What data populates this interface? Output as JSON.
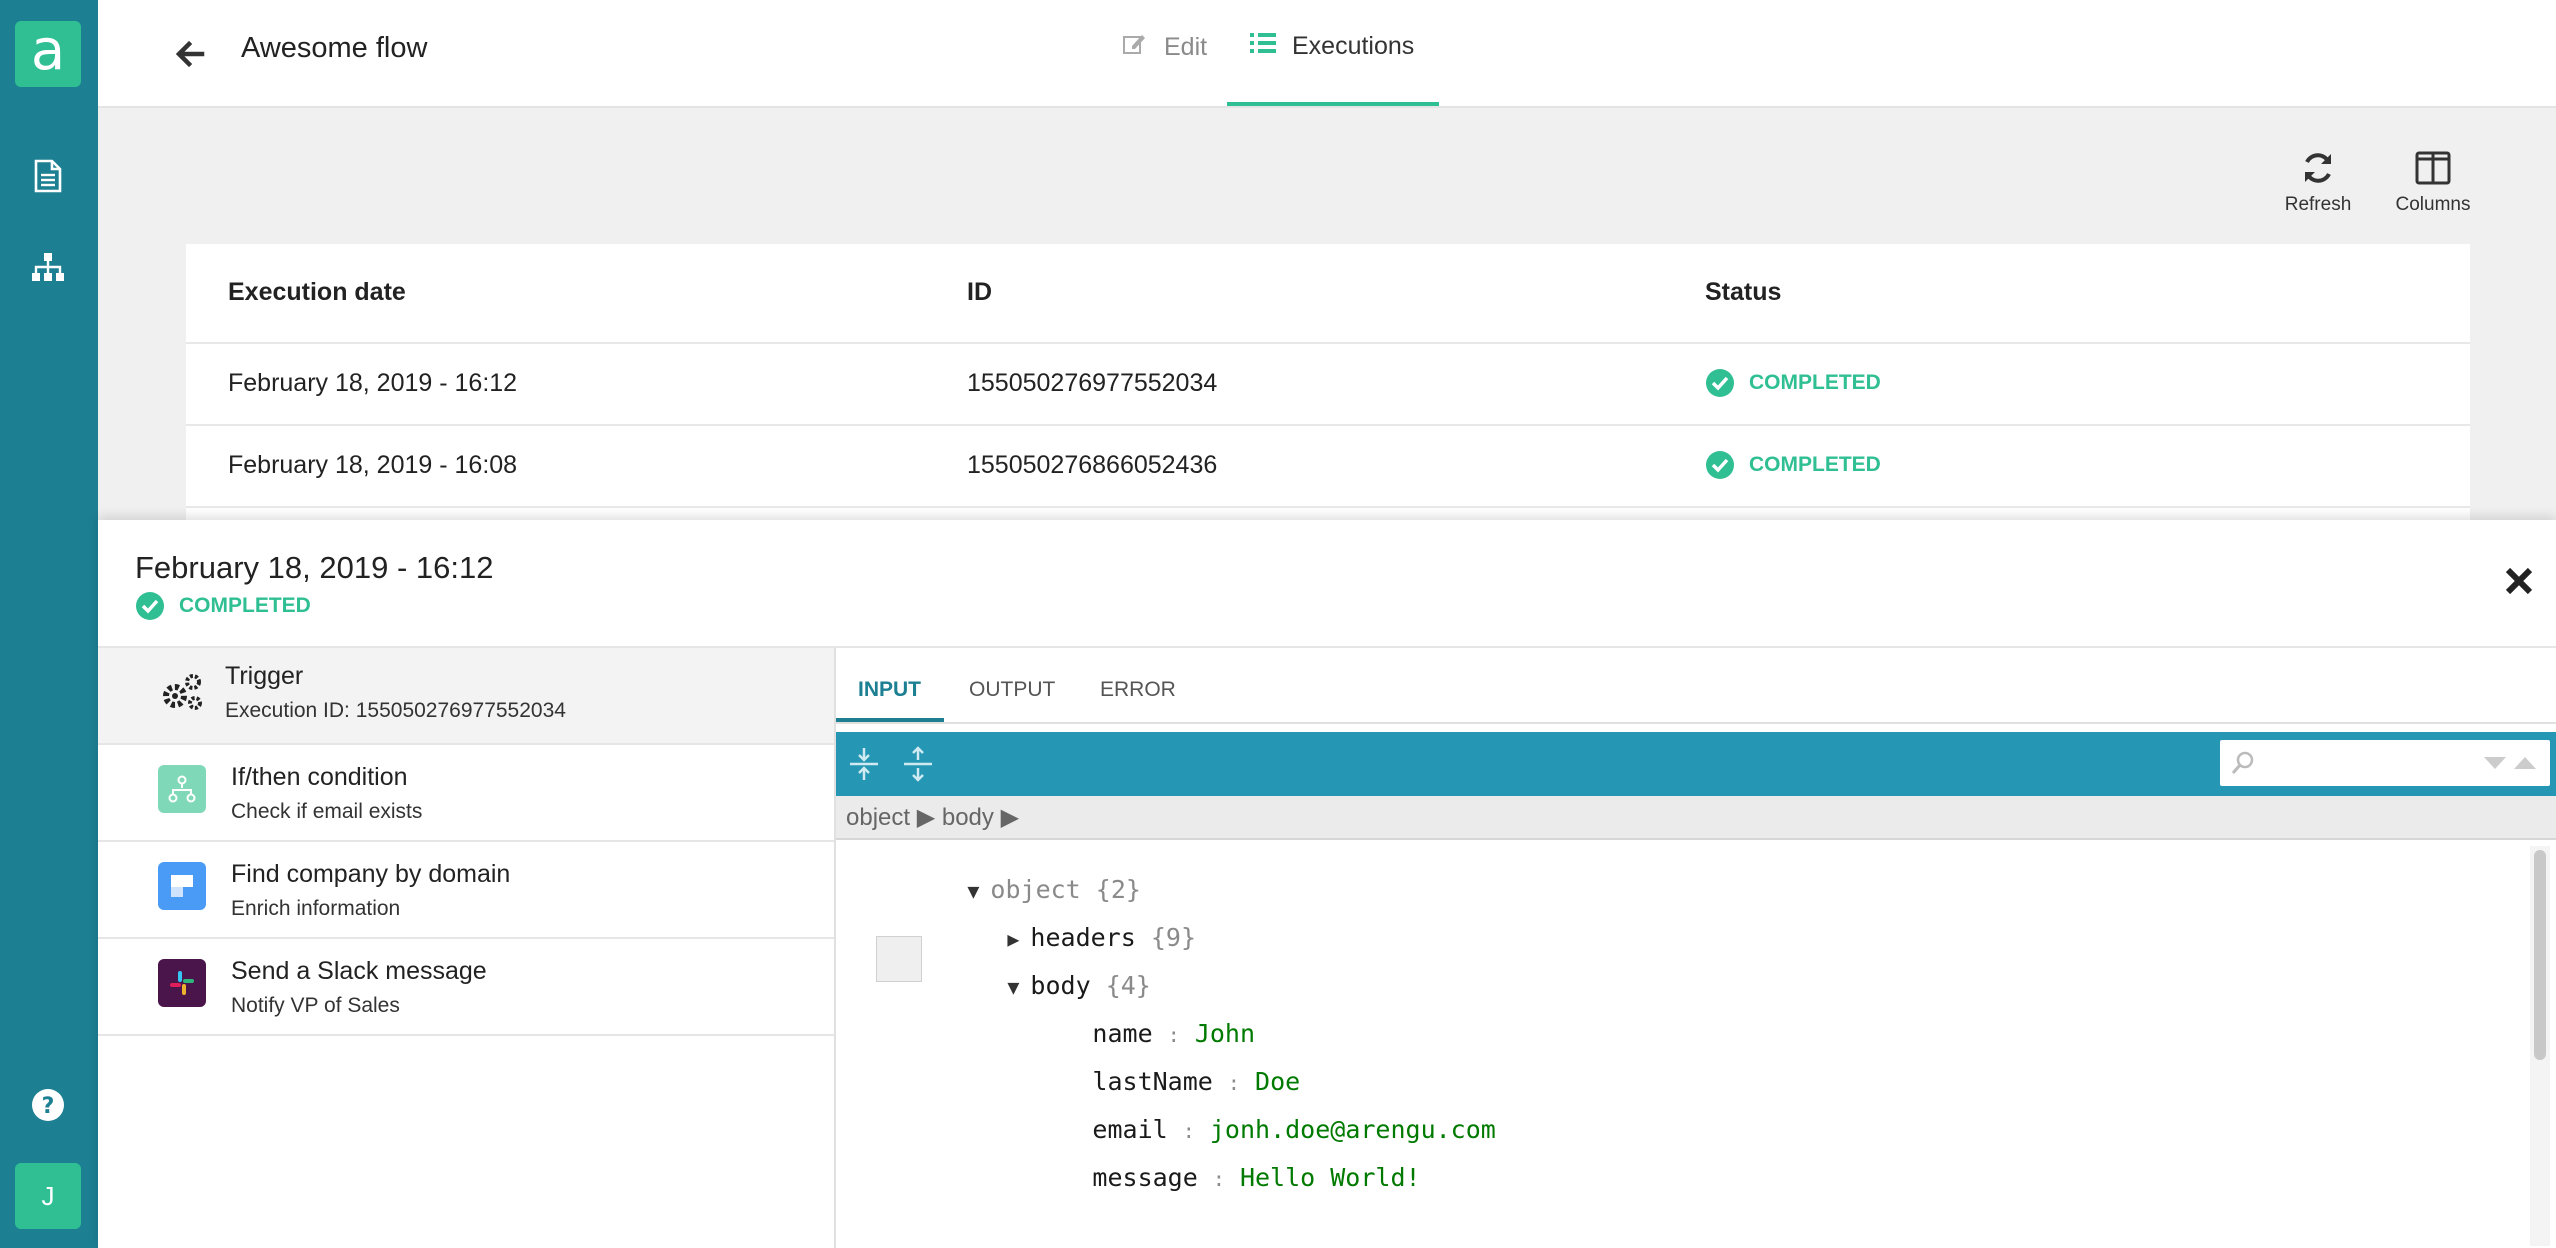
{
  "app": {
    "logo_letter": "a",
    "user_initial": "J"
  },
  "rail": {
    "icons": [
      "document-icon",
      "sitemap-icon"
    ],
    "help": "help-icon"
  },
  "header": {
    "flow_title": "Awesome flow",
    "tabs": [
      {
        "label": "Edit",
        "active": false
      },
      {
        "label": "Executions",
        "active": true
      }
    ]
  },
  "toolbar": {
    "refresh_label": "Refresh",
    "columns_label": "Columns"
  },
  "table": {
    "columns": [
      "Execution date",
      "ID",
      "Status"
    ],
    "rows": [
      {
        "date": "February 18, 2019 - 16:12",
        "id": "155050276977552034",
        "status": "COMPLETED"
      },
      {
        "date": "February 18, 2019 - 16:08",
        "id": "155050276866052436",
        "status": "COMPLETED"
      }
    ]
  },
  "detail": {
    "title": "February 18, 2019 - 16:12",
    "status": "COMPLETED",
    "steps": [
      {
        "title": "Trigger",
        "subtitle": "Execution ID: 155050276977552034",
        "icon": "gears-icon",
        "active": true
      },
      {
        "title": "If/then condition",
        "subtitle": "Check if email exists",
        "icon": "branch-icon",
        "color": "#7fd9b8"
      },
      {
        "title": "Find company by domain",
        "subtitle": "Enrich information",
        "icon": "clearbit-icon",
        "color": "#4a9bf5"
      },
      {
        "title": "Send a Slack message",
        "subtitle": "Notify VP of Sales",
        "icon": "slack-icon",
        "color": "#4a154b"
      }
    ],
    "io_tabs": [
      "INPUT",
      "OUTPUT",
      "ERROR"
    ],
    "breadcrumb": [
      "object",
      "body"
    ],
    "search_placeholder": "",
    "tree": {
      "root": {
        "key": "object",
        "count": "{2}"
      },
      "headers": {
        "key": "headers",
        "count": "{9}"
      },
      "body": {
        "key": "body",
        "count": "{4}"
      },
      "fields": [
        {
          "key": "name",
          "value": "John"
        },
        {
          "key": "lastName",
          "value": "Doe"
        },
        {
          "key": "email",
          "value": "jonh.doe@arengu.com"
        },
        {
          "key": "message",
          "value": "Hello World!"
        }
      ]
    }
  },
  "colors": {
    "rail": "#1d7f92",
    "accent": "#2fbf93",
    "json_bar": "#2596b3",
    "value_green": "#007a00"
  }
}
